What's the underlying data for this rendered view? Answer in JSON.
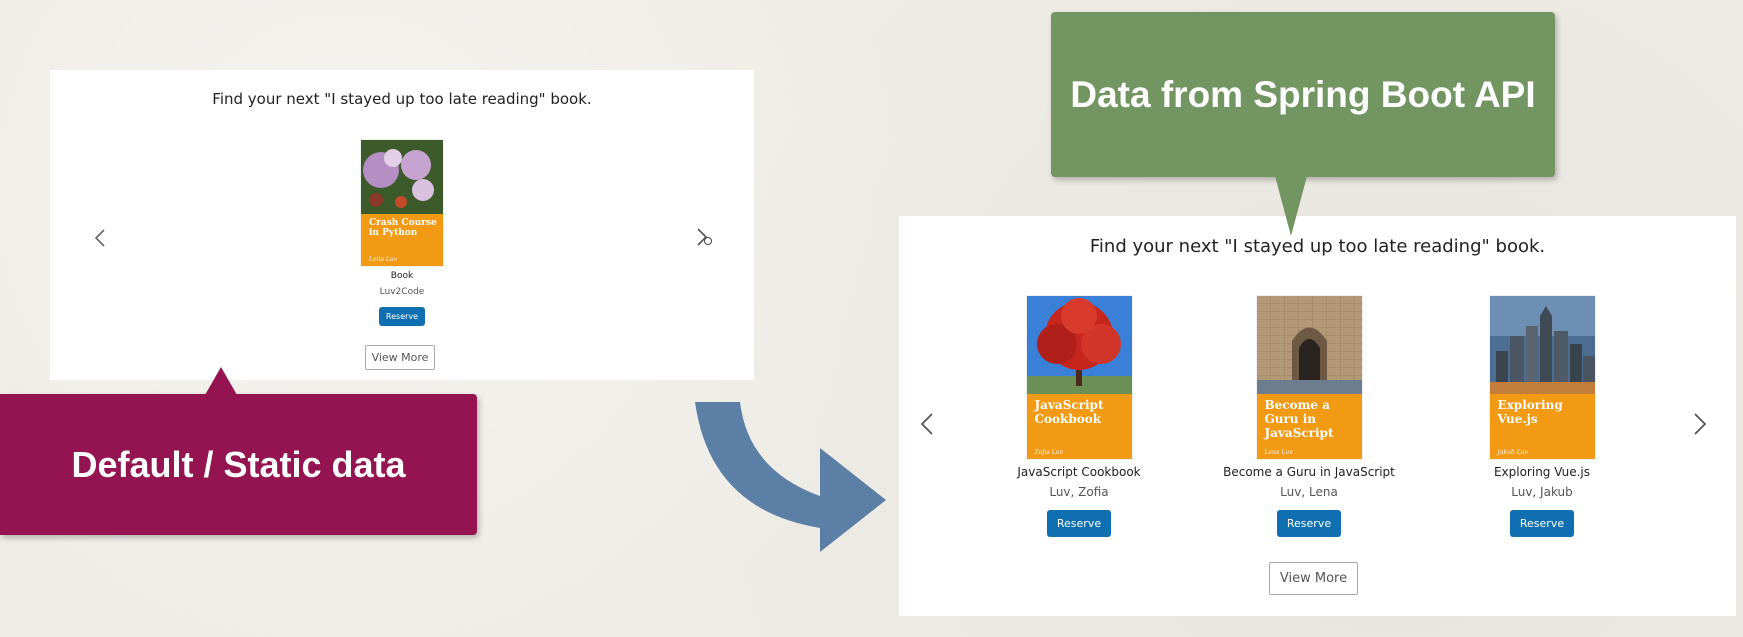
{
  "static_panel": {
    "heading": "Find your next \"I stayed up too late reading\" book.",
    "book": {
      "cover_title": "Crash Course in Python",
      "cover_author": "Leila Luv",
      "title": "Book",
      "author": "Luv2Code",
      "reserve_label": "Reserve"
    },
    "view_more_label": "View More"
  },
  "api_panel": {
    "heading": "Find your next \"I stayed up too late reading\" book.",
    "books": [
      {
        "cover_title": "JavaScript Cookbook",
        "cover_author": "Zofia Luv",
        "title": "JavaScript Cookbook",
        "author": "Luv, Zofia",
        "reserve_label": "Reserve"
      },
      {
        "cover_title": "Become a Guru in JavaScript",
        "cover_author": "Lena Luv",
        "title": "Become a Guru in JavaScript",
        "author": "Luv, Lena",
        "reserve_label": "Reserve"
      },
      {
        "cover_title": "Exploring Vue.js",
        "cover_author": "Jakub Luv",
        "title": "Exploring Vue.js",
        "author": "Luv, Jakub",
        "reserve_label": "Reserve"
      }
    ],
    "view_more_label": "View More"
  },
  "callouts": {
    "api_label": "Data from Spring Boot API",
    "static_label": "Default / Static data"
  },
  "icons": {
    "prev": "chevron-left-icon",
    "next": "chevron-right-icon",
    "flow": "curved-arrow-icon"
  },
  "colors": {
    "api_callout": "#729562",
    "static_callout": "#931450",
    "reserve_button": "#0f6fb0",
    "cover_band": "#f29a14",
    "flow_arrow": "#5c7fa6"
  }
}
